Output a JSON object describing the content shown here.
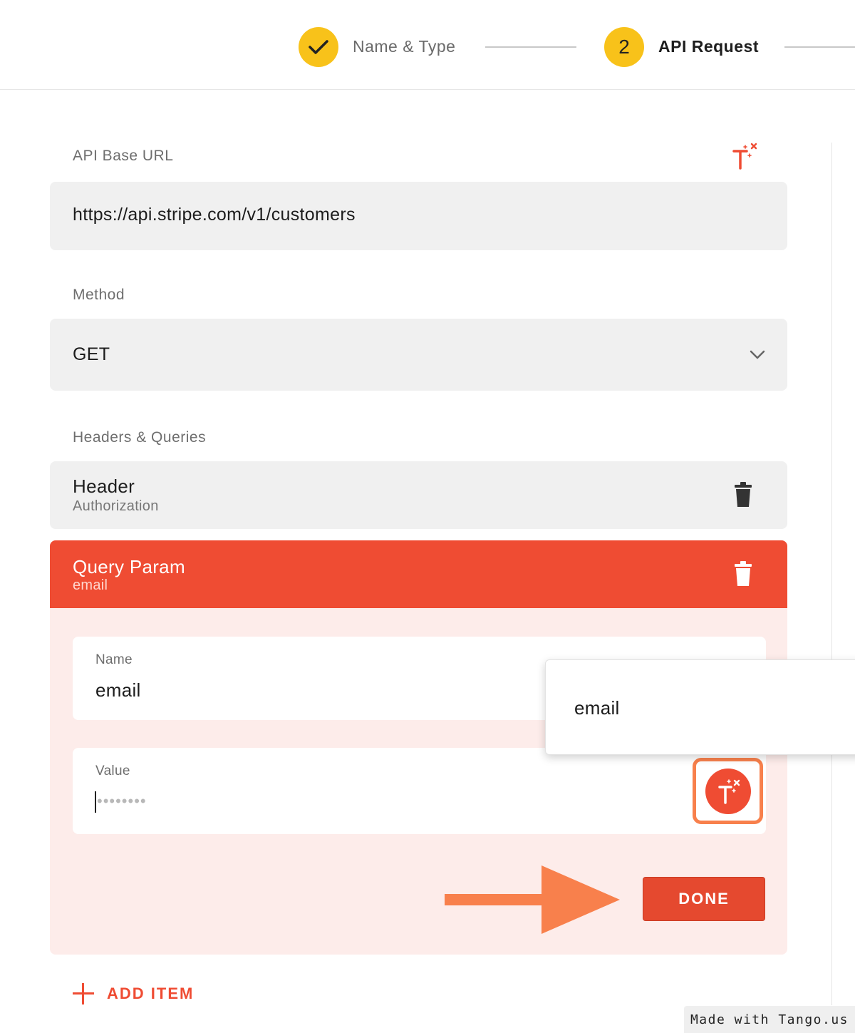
{
  "stepper": {
    "step1": {
      "label": "Name & Type",
      "state": "completed",
      "icon": "check-icon"
    },
    "step2": {
      "number": "2",
      "label": "API Request",
      "state": "active"
    },
    "accent_color": "#f8c21a"
  },
  "form": {
    "base_url": {
      "label": "API Base URL",
      "value": "https://api.stripe.com/v1/customers",
      "icon": "tango-magic-icon"
    },
    "method": {
      "label": "Method",
      "value": "GET",
      "icon": "chevron-down-icon"
    },
    "headers_queries": {
      "label": "Headers & Queries",
      "items": [
        {
          "type": "Header",
          "name": "Authorization",
          "icon": "trash-icon"
        },
        {
          "type": "Query Param",
          "name": "email",
          "icon": "trash-icon",
          "expanded": true
        }
      ]
    },
    "query_editor": {
      "name_label": "Name",
      "name_value": "email",
      "value_label": "Value",
      "value_masked": "••••••••",
      "suggestion": "email",
      "done_label": "DONE"
    },
    "add_item_label": "ADD ITEM"
  },
  "colors": {
    "primary_red": "#ef4c33",
    "panel_pink": "#fdecea",
    "highlight_orange": "#f8804c"
  },
  "watermark": "Made with Tango.us"
}
